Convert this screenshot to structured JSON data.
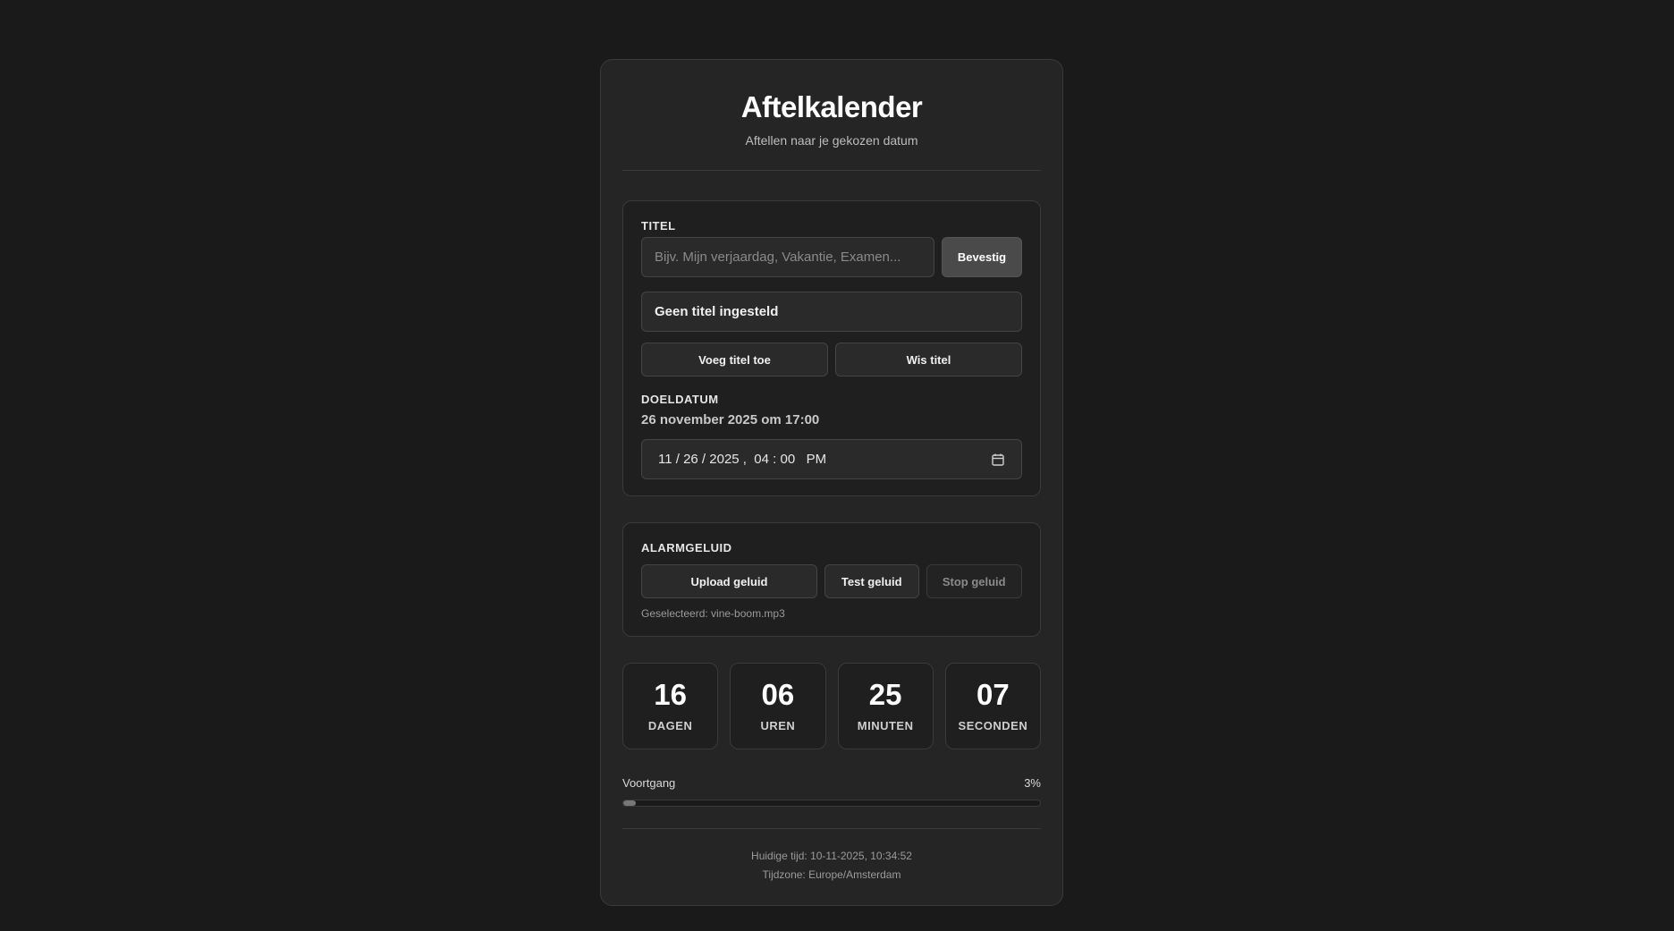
{
  "header": {
    "title": "Aftelkalender",
    "subtitle": "Aftellen naar je gekozen datum"
  },
  "title_section": {
    "label": "TITEL",
    "input_placeholder": "Bijv. Mijn verjaardag, Vakantie, Examen...",
    "input_value": "",
    "confirm_label": "Bevestig",
    "current_title": "Geen titel ingesteld",
    "add_label": "Voeg titel toe",
    "clear_label": "Wis titel"
  },
  "target_section": {
    "label": "DOELDATUM",
    "readout": "26 november 2025 om 17:00",
    "datetime_value": "11 / 26 / 2025 ,  04 : 00   PM",
    "icon": "calendar-icon"
  },
  "alarm_section": {
    "label": "ALARMGELUID",
    "upload_label": "Upload geluid",
    "test_label": "Test geluid",
    "stop_label": "Stop geluid",
    "selected_text": "Geselecteerd: vine-boom.mp3"
  },
  "countdown": {
    "days": "16",
    "days_label": "DAGEN",
    "hours": "06",
    "hours_label": "UREN",
    "minutes": "25",
    "minutes_label": "MINUTEN",
    "seconds": "07",
    "seconds_label": "SECONDEN"
  },
  "progress": {
    "label": "Voortgang",
    "percent_text": "3%",
    "fraction": 0.03
  },
  "footer": {
    "current_time": "Huidige tijd: 10-11-2025, 10:34:52",
    "timezone": "Tijdzone: Europe/Amsterdam"
  }
}
